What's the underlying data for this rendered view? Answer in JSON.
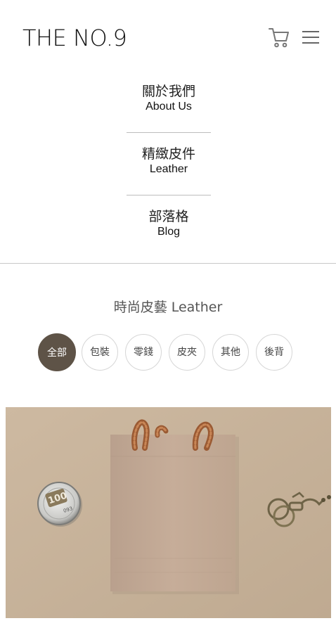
{
  "header": {
    "logo": "THE NO.9",
    "cart_icon": "cart-icon",
    "menu_icon": "hamburger-menu-icon"
  },
  "nav": {
    "items": [
      {
        "zh": "關於我們",
        "en": "About Us"
      },
      {
        "zh": "精緻皮件",
        "en": "Leather"
      },
      {
        "zh": "部落格",
        "en": "Blog"
      }
    ]
  },
  "section": {
    "title": "時尚皮藝 Leather"
  },
  "filters": [
    {
      "label": "全部",
      "active": true
    },
    {
      "label": "包裝",
      "active": false
    },
    {
      "label": "零錢",
      "active": false
    },
    {
      "label": "皮夾",
      "active": false
    },
    {
      "label": "其他",
      "active": false
    },
    {
      "label": "後背",
      "active": false
    }
  ],
  "product": {
    "tin_label_top": "100",
    "tin_label_code": "093"
  },
  "colors": {
    "active_filter": "#5e5347",
    "background_tan": "#c7b39b",
    "bag": "#c2a995",
    "rope": "#a5653c"
  }
}
